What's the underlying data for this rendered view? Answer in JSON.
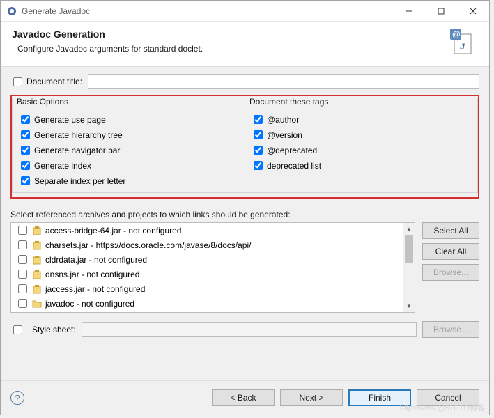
{
  "window": {
    "title": "Generate Javadoc"
  },
  "header": {
    "title": "Javadoc Generation",
    "subtitle": "Configure Javadoc arguments for standard doclet."
  },
  "docTitle": {
    "checkboxLabel": "Document title:",
    "value": ""
  },
  "basicOptions": {
    "legend": "Basic Options",
    "items": {
      "usePage": "Generate use page",
      "hierarchy": "Generate hierarchy tree",
      "navigator": "Generate navigator bar",
      "index": "Generate index",
      "separateIndex": "Separate index per letter"
    }
  },
  "docTags": {
    "legend": "Document these tags",
    "items": {
      "author": "@author",
      "version": "@version",
      "deprecated": "@deprecated",
      "deprecatedList": "deprecated list"
    }
  },
  "refs": {
    "label": "Select referenced archives and projects to which links should be generated:",
    "items": [
      "access-bridge-64.jar - not configured",
      "charsets.jar - https://docs.oracle.com/javase/8/docs/api/",
      "cldrdata.jar - not configured",
      "dnsns.jar - not configured",
      "jaccess.jar - not configured",
      "javadoc - not configured"
    ],
    "buttons": {
      "selectAll": "Select All",
      "clearAll": "Clear All",
      "browse": "Browse..."
    }
  },
  "styleSheet": {
    "label": "Style sheet:",
    "browse": "Browse..."
  },
  "footer": {
    "back": "< Back",
    "next": "Next >",
    "finish": "Finish",
    "cancel": "Cancel"
  },
  "watermark": "http://www.@51CTO博客"
}
